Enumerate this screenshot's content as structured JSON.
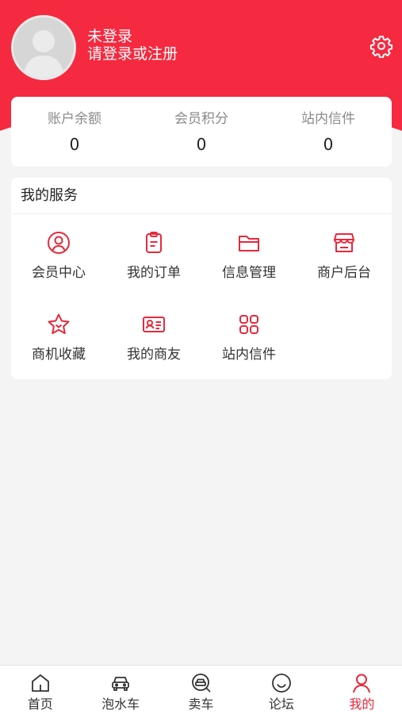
{
  "user": {
    "status": "未登录",
    "prompt": "请登录或注册"
  },
  "stats": [
    {
      "label": "账户余额",
      "value": "0"
    },
    {
      "label": "会员积分",
      "value": "0"
    },
    {
      "label": "站内信件",
      "value": "0"
    }
  ],
  "services": {
    "title": "我的服务",
    "items": [
      {
        "label": "会员中心",
        "icon": "user-circle-icon"
      },
      {
        "label": "我的订单",
        "icon": "clipboard-icon"
      },
      {
        "label": "信息管理",
        "icon": "folder-icon"
      },
      {
        "label": "商户后台",
        "icon": "store-icon"
      },
      {
        "label": "商机收藏",
        "icon": "star-icon"
      },
      {
        "label": "我的商友",
        "icon": "id-card-icon"
      },
      {
        "label": "站内信件",
        "icon": "grid-icon"
      }
    ]
  },
  "tabbar": {
    "items": [
      {
        "label": "首页",
        "icon": "home-icon"
      },
      {
        "label": "泡水车",
        "icon": "car-icon"
      },
      {
        "label": "卖车",
        "icon": "car-search-icon"
      },
      {
        "label": "论坛",
        "icon": "smile-icon"
      },
      {
        "label": "我的",
        "icon": "person-icon"
      }
    ],
    "active_index": 4
  },
  "colors": {
    "brand": "#f5293f",
    "icon": "#e8293c"
  }
}
